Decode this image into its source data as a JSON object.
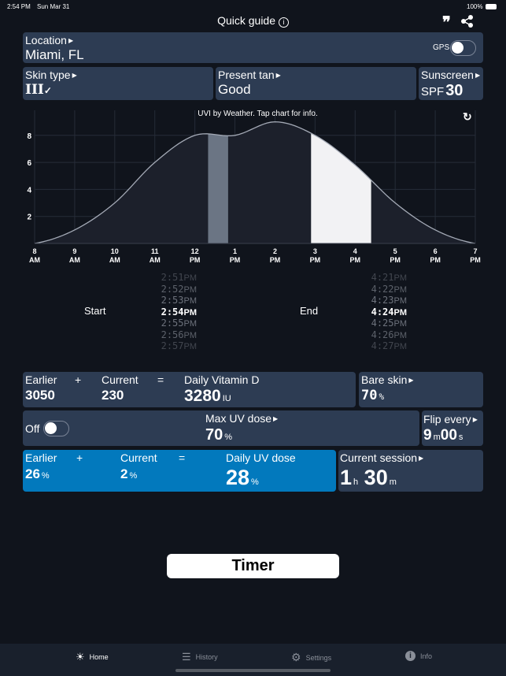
{
  "status": {
    "time": "2:54 PM",
    "date": "Sun Mar 31",
    "battery": "100%"
  },
  "header": {
    "title": "Quick guide",
    "info_icon": "info-circle-icon",
    "quote_icon": "quote-icon",
    "share_icon": "share-icon"
  },
  "location": {
    "label": "Location",
    "value": "Miami, FL",
    "gps_label": "GPS",
    "gps_on": false
  },
  "skin_type": {
    "label": "Skin type",
    "value": "III",
    "check": "✓"
  },
  "present_tan": {
    "label": "Present tan",
    "value": "Good"
  },
  "sunscreen": {
    "label": "Sunscreen",
    "prefix": "SPF",
    "value": "30"
  },
  "chart_caption": "UVI by  Weather. Tap chart for info.",
  "chart_data": {
    "type": "area",
    "x_hours": [
      8,
      9,
      10,
      11,
      12,
      13,
      14,
      15,
      16,
      17,
      18,
      19
    ],
    "uvi": [
      0,
      1,
      3,
      6,
      8,
      8,
      9,
      8,
      5.8,
      3,
      1,
      0
    ],
    "yticks": [
      "2",
      "4",
      "6",
      "8"
    ],
    "ylim": [
      0,
      9.5
    ],
    "xticks": [
      [
        "8",
        "AM"
      ],
      [
        "9",
        "AM"
      ],
      [
        "10",
        "AM"
      ],
      [
        "11",
        "AM"
      ],
      [
        "12",
        "PM"
      ],
      [
        "1",
        "PM"
      ],
      [
        "2",
        "PM"
      ],
      [
        "3",
        "PM"
      ],
      [
        "4",
        "PM"
      ],
      [
        "5",
        "PM"
      ],
      [
        "6",
        "PM"
      ],
      [
        "7",
        "PM"
      ]
    ],
    "earlier_session": [
      12.33,
      12.83
    ],
    "current_session": [
      14.9,
      16.4
    ],
    "grid": true
  },
  "start": {
    "label": "Start",
    "times": [
      "2:51",
      "2:52",
      "2:53",
      "2:54",
      "2:55",
      "2:56",
      "2:57"
    ],
    "ampm": "PM",
    "selected": 3
  },
  "end": {
    "label": "End",
    "times": [
      "4:21",
      "4:22",
      "4:23",
      "4:24",
      "4:25",
      "4:26",
      "4:27"
    ],
    "ampm": "PM",
    "selected": 3
  },
  "vitd": {
    "earlier_label": "Earlier",
    "plus": "+",
    "current_label": "Current",
    "eq": "=",
    "total_label": "Daily Vitamin D",
    "earlier": "3050",
    "current": "230",
    "total": "3280",
    "unit": "IU"
  },
  "bare_skin": {
    "label": "Bare skin",
    "value": "70",
    "unit": "%"
  },
  "max_uv": {
    "toggle_label": "Off",
    "label": "Max UV dose",
    "value": "70",
    "unit": "%"
  },
  "flip": {
    "label": "Flip every",
    "m": "9",
    "m_unit": "m",
    "s": "00",
    "s_unit": "s"
  },
  "uv": {
    "earlier_label": "Earlier",
    "plus": "+",
    "current_label": "Current",
    "eq": "=",
    "total_label": "Daily UV dose",
    "earlier": "26",
    "current": "2",
    "total": "28",
    "unit": "%"
  },
  "session": {
    "label": "Current session",
    "h": "1",
    "h_unit": "h",
    "m": "30",
    "m_unit": "m"
  },
  "timer_label": "Timer",
  "tabs": [
    {
      "label": "Home",
      "icon": "sun-icon"
    },
    {
      "label": "History",
      "icon": "list-icon"
    },
    {
      "label": "Settings",
      "icon": "gear-icon"
    },
    {
      "label": "Info",
      "icon": "info-icon"
    }
  ],
  "colors": {
    "card": "#2d3c53",
    "accent": "#0279bd",
    "bg": "#10141c"
  }
}
